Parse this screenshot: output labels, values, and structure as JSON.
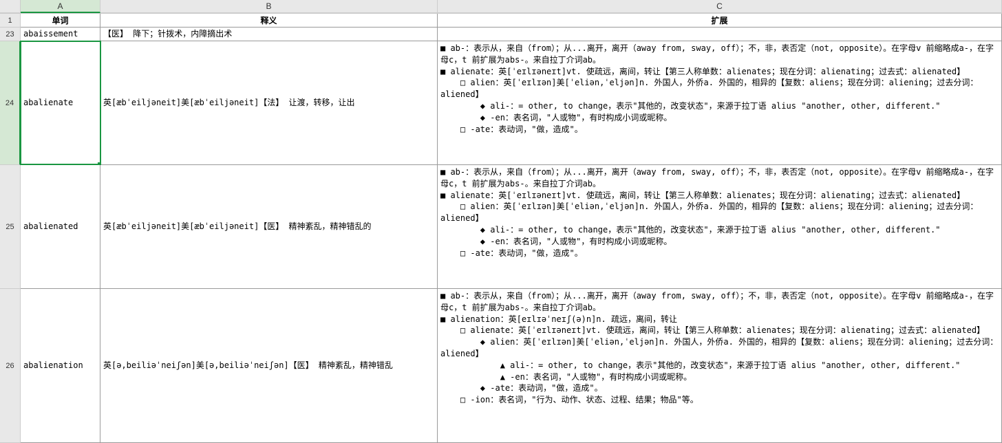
{
  "columns": {
    "A": "A",
    "B": "B",
    "C": "C"
  },
  "headerRow": {
    "num": "1",
    "A": "单词",
    "B": "释义",
    "C": "扩展"
  },
  "rows": [
    {
      "num": "23",
      "A": "abaissement",
      "B": "【医】 降下；针拨术，内障摘出术",
      "C": ""
    },
    {
      "num": "24",
      "A": "abalienate",
      "B": "英[æbˈeiljəneit]美[æbˈeiljəneit]【法】 让渡，转移，让出",
      "C": "■ ab-：表示从，来自（from）；从...离开，离开（away from, sway, off）；不，非，表否定（not, opposite）。在字母v 前缩略成a-，在字母c，t 前扩展为abs-。来自拉丁介词ab。\n■ alienate：英[ˈeɪlɪəneɪt]vt. 使疏远，离间，转让【第三人称单数：alienates；现在分词：alienating；过去式：alienated】\n    □ alien：英[ˈeɪlɪən]美[ˈeliən,ˈeljən]n. 外国人，外侨a. 外国的，相异的【复数：aliens；现在分词：aliening；过去分词：aliened】\n        ◆ ali-：= other, to change，表示\"其他的，改变状态\"，来源于拉丁语 alius \"another, other, different.\"\n        ◆ -en：表名词，\"人或物\"，有时构成小词或昵称。\n    □ -ate：表动词，\"做，造成\"。"
    },
    {
      "num": "25",
      "A": "abalienated",
      "B": "英[æbˈeiljəneit]美[æbˈeiljəneit]【医】 精神紊乱，精神错乱的",
      "C": "■ ab-：表示从，来自（from）；从...离开，离开（away from, sway, off）；不，非，表否定（not, opposite）。在字母v 前缩略成a-，在字母c，t 前扩展为abs-。来自拉丁介词ab。\n■ alienate：英[ˈeɪlɪəneɪt]vt. 使疏远，离间，转让【第三人称单数：alienates；现在分词：alienating；过去式：alienated】\n    □ alien：英[ˈeɪlɪən]美[ˈeliən,ˈeljən]n. 外国人，外侨a. 外国的，相异的【复数：aliens；现在分词：aliening；过去分词：aliened】\n        ◆ ali-：= other, to change，表示\"其他的，改变状态\"，来源于拉丁语 alius \"another, other, different.\"\n        ◆ -en：表名词，\"人或物\"，有时构成小词或昵称。\n    □ -ate：表动词，\"做，造成\"。"
    },
    {
      "num": "26",
      "A": "abalienation",
      "B": "英[ə,beiliəˈneiʃən]美[ə,beiliəˈneiʃən]【医】 精神紊乱，精神错乱",
      "C": "■ ab-：表示从，来自（from）；从...离开，离开（away from, sway, off）；不，非，表否定（not, opposite）。在字母v 前缩略成a-，在字母c，t 前扩展为abs-。来自拉丁介词ab。\n■ alienation：英[eɪlɪəˈneɪʃ(ə)n]n. 疏远，离间，转让\n    □ alienate：英[ˈeɪlɪəneɪt]vt. 使疏远，离间，转让【第三人称单数：alienates；现在分词：alienating；过去式：alienated】\n        ◆ alien：英[ˈeɪlɪən]美[ˈeliən,ˈeljən]n. 外国人，外侨a. 外国的，相异的【复数：aliens；现在分词：aliening；过去分词：aliened】\n            ▲ ali-：= other, to change，表示\"其他的，改变状态\"，来源于拉丁语 alius \"another, other, different.\"\n            ▲ -en：表名词，\"人或物\"，有时构成小词或昵称。\n        ◆ -ate：表动词，\"做，造成\"。\n    □ -ion：表名词，\"行为、动作、状态、过程、结果；物品\"等。"
    }
  ],
  "selectedCell": "A24"
}
